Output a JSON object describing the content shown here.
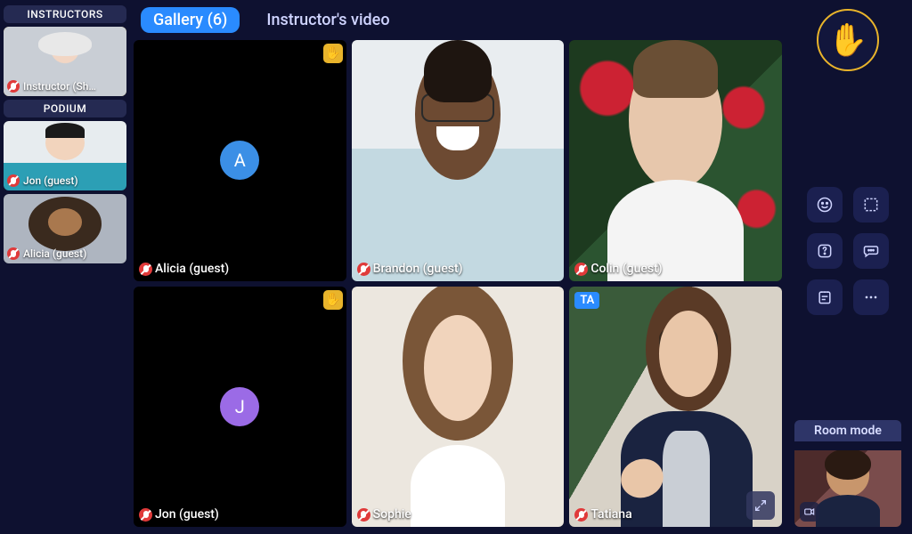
{
  "sidebar": {
    "sections": [
      {
        "title": "INSTRUCTORS",
        "items": [
          {
            "name": "Instructor (Sh…",
            "muted": true,
            "face": "face-instructor"
          }
        ]
      },
      {
        "title": "PODIUM",
        "items": [
          {
            "name": "Jon (guest)",
            "muted": true,
            "face": "face-jon-sm"
          },
          {
            "name": "Alicia (guest)",
            "muted": true,
            "face": "face-alicia-sm"
          }
        ]
      }
    ]
  },
  "tabs": {
    "gallery": "Gallery (6)",
    "instructor_video": "Instructor's video",
    "active": "gallery"
  },
  "participants": [
    {
      "name": "Alicia (guest)",
      "muted": true,
      "hand": true,
      "avatar_letter": "A",
      "avatar_color": "avatar-a",
      "camera_off": true
    },
    {
      "name": "Brandon (guest)",
      "muted": true,
      "face": "face-brandon"
    },
    {
      "name": "Colin (guest)",
      "muted": true,
      "face": "face-colin"
    },
    {
      "name": "Jon (guest)",
      "muted": true,
      "hand": true,
      "avatar_letter": "J",
      "avatar_color": "avatar-j",
      "camera_off": true
    },
    {
      "name": "Sophie",
      "muted": true,
      "face": "face-sophie"
    },
    {
      "name": "Tatiana",
      "muted": true,
      "face": "face-tatiana",
      "badge": "TA",
      "expand": true
    }
  ],
  "right": {
    "buttons": [
      "reactions",
      "layout",
      "help",
      "chat",
      "notes",
      "more"
    ],
    "room_mode_label": "Room mode"
  },
  "icons": {
    "hand_emoji": "✋"
  }
}
